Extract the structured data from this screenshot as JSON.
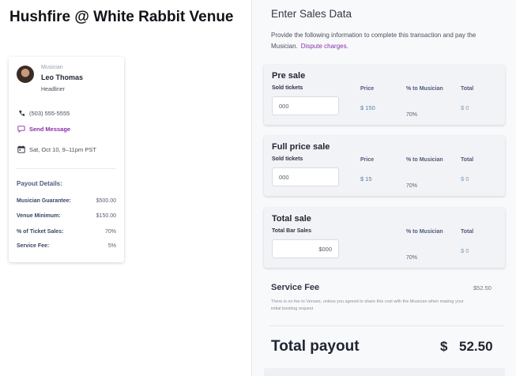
{
  "event": {
    "title": "Hushfire @ White Rabbit Venue"
  },
  "musician": {
    "role_label": "Musician",
    "name": "Leo Thomas",
    "billing": "Headliner",
    "phone": "(503) 555-5555",
    "send_message": "Send Message",
    "datetime": "Sat, Oct 10, 9–11pm PST"
  },
  "payout_details": {
    "heading": "Payout Details:",
    "items": [
      {
        "label": "Musician Guarantee:",
        "value": "$500.00"
      },
      {
        "label": "Venue Minimum:",
        "value": "$150.00"
      },
      {
        "label": "% of Ticket Sales:",
        "value": "70%"
      },
      {
        "label": "Service Fee:",
        "value": "5%"
      }
    ]
  },
  "form": {
    "heading": "Enter Sales Data",
    "intro": "Provide the following information to complete this transaction and pay the Musician.",
    "dispute_link": "Dispute charges.",
    "presale": {
      "title": "Pre sale",
      "field_label": "Sold tickets",
      "input_value": "000",
      "price_label": "Price",
      "price_value": "$ 150",
      "pct_label": "% to Musician",
      "pct_value": "70%",
      "total_label": "Total",
      "total_value": "$ 0"
    },
    "fullprice": {
      "title": "Full price sale",
      "field_label": "Sold tickets",
      "input_value": "000",
      "price_label": "Price",
      "price_value": "$ 15",
      "pct_label": "% to Musician",
      "pct_value": "70%",
      "total_label": "Total",
      "total_value": "$ 0"
    },
    "totalsale": {
      "title": "Total sale",
      "field_label": "Total Bar Sales",
      "input_value": "$000",
      "pct_label": "% to Musician",
      "pct_value": "70%",
      "total_label": "Total",
      "total_value": "$ 0"
    },
    "service_fee": {
      "label": "Service Fee",
      "value": "$52.50",
      "note": "There is no fee to Venues, unless you agreed to share this cost with the Musician when making your initial booking request"
    },
    "total_payout": {
      "label": "Total payout",
      "currency": "$",
      "value": "52.50"
    }
  },
  "colors": {
    "accent": "#8b2fa8",
    "muted_blue": "#5a7ea1",
    "heading_blue": "#4f5a7a"
  }
}
